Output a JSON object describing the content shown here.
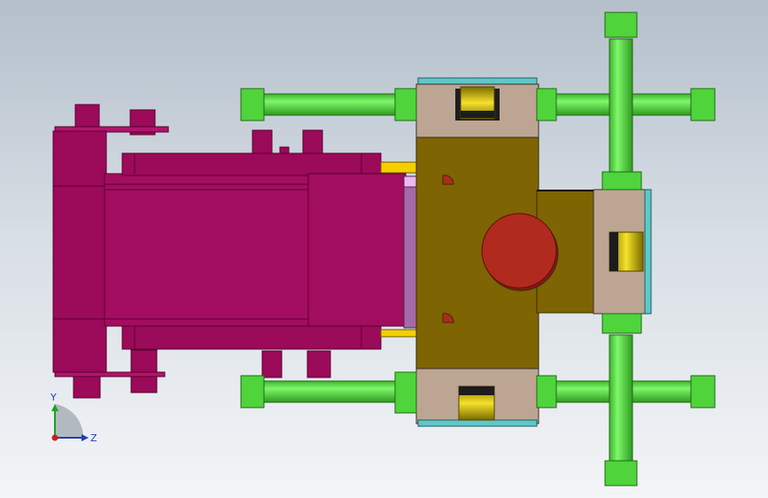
{
  "viewport": {
    "background_top": "#b4bfca",
    "background_bottom": "#f3f5f7"
  },
  "model": {
    "colors": {
      "pump_body": "#9c0a5a",
      "pump_body_edge": "#5a0030",
      "manifold": "#7e6403",
      "valve_block": "#bda593",
      "pipe": "#5ee24b",
      "pipe_edge": "#1f6a12",
      "plunger_head": "#b61e24",
      "crosshead_guide": "#a56aa8",
      "valve_core": "#c9b400",
      "cover_plate": "#5fc8c8",
      "yellow_rod": "#f4d000"
    }
  },
  "triad": {
    "y_label": "Y",
    "z_label": "Z",
    "y_color": "#1aa31a",
    "z_color": "#1f3fb8",
    "origin_color": "#d01d1d"
  }
}
